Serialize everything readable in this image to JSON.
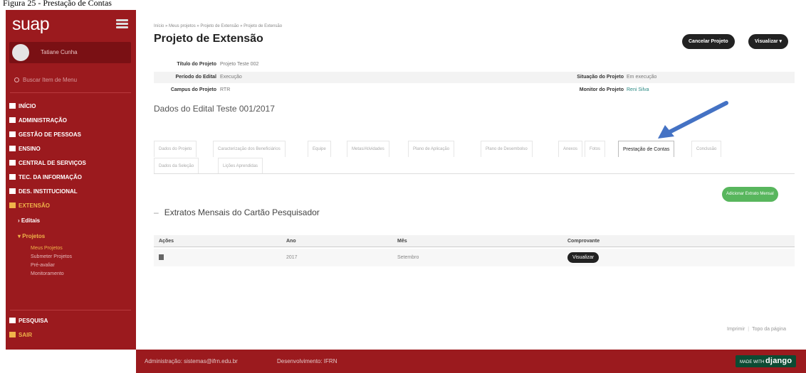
{
  "caption": "Figura 25 - Prestação de Contas",
  "sidebar": {
    "logo": "suap",
    "user": "Tatiane Cunha",
    "search_placeholder": "Buscar Item de Menu",
    "items": [
      {
        "label": "Início",
        "icon": "home-icon"
      },
      {
        "label": "Administração",
        "icon": "list-icon"
      },
      {
        "label": "Gestão de Pessoas",
        "icon": "people-icon"
      },
      {
        "label": "Ensino",
        "icon": "pencil-icon"
      },
      {
        "label": "Central de Serviços",
        "icon": "list-icon"
      },
      {
        "label": "Tec. da Informação",
        "icon": "monitor-icon"
      },
      {
        "label": "Des. Institucional",
        "icon": "bar-chart-icon"
      },
      {
        "label": "Extensão",
        "icon": "grid-icon"
      }
    ],
    "submenu": {
      "editais": "Editais",
      "projetos": "Projetos",
      "projetos_items": [
        "Meus Projetos",
        "Submeter Projetos",
        "Pré-avaliar",
        "Monitoramento"
      ]
    },
    "pesquisa": "Pesquisa",
    "sair": "Sair"
  },
  "breadcrumb": "Início » Meus projetos » Projeto de Extensão » Projeto de Extensão",
  "page_title": "Projeto de Extensão",
  "actions": {
    "cancel": "Cancelar Projeto",
    "view": "Visualizar"
  },
  "info": {
    "titulo_label": "Título do Projeto",
    "titulo_value": "Projeto Teste 002",
    "periodo_label": "Período do Edital",
    "periodo_value": "Execução",
    "situacao_label": "Situação do Projeto",
    "situacao_value": "Em execução",
    "campus_label": "Campus do Projeto",
    "campus_value": "RTR",
    "monitor_label": "Monitor do Projeto",
    "monitor_value": "Reni Silva"
  },
  "edital_title": "Dados do Edital Teste 001/2017",
  "tabs": [
    "Dados do Projeto",
    "Caracterização dos Beneficiários",
    "Equipe",
    "Metas/Atividades",
    "Plano de Aplicação",
    "Plano de Desembolso",
    "Anexos",
    "Fotos",
    "Prestação de Contas",
    "Conclusão",
    "Dados da Seleção",
    "Lições Aprendidas"
  ],
  "active_tab": "Prestação de Contas",
  "add_button": "Adicionar Extrato Mensal",
  "section_title": "Extratos Mensais do Cartão Pesquisador",
  "table": {
    "headers": [
      "Ações",
      "Ano",
      "Mês",
      "Comprovante"
    ],
    "rows": [
      {
        "ano": "2017",
        "mes": "Setembro",
        "comprovante": "Visualizar"
      }
    ]
  },
  "bottom_links": {
    "print": "Imprimir",
    "top": "Topo da página"
  },
  "footer": {
    "left": "Administração: sistemas@ifrn.edu.br",
    "mid": "Desenvolvimento: IFRN",
    "badge_small": "MADE WITH",
    "badge_big": "django"
  },
  "colors": {
    "brand": "#9b1a1e",
    "accent": "#f0b44a",
    "success": "#58b65d",
    "arrow": "#4472c4"
  }
}
